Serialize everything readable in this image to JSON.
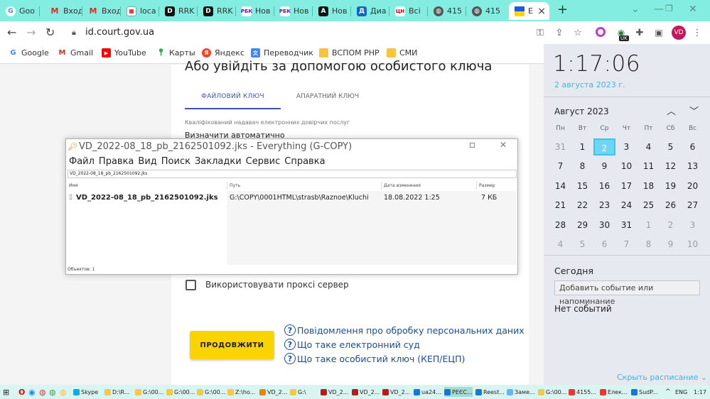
{
  "browser": {
    "tabs": [
      {
        "label": "Goo",
        "icon": "google-icon"
      },
      {
        "label": "Вход",
        "icon": "gmail-icon"
      },
      {
        "label": "Вход",
        "icon": "gmail-icon"
      },
      {
        "label": "loca",
        "icon": "localhost-icon"
      },
      {
        "label": "RRK",
        "icon": "rrk-icon"
      },
      {
        "label": "RRK",
        "icon": "rrk-icon"
      },
      {
        "label": "Нов",
        "icon": "rbc-icon"
      },
      {
        "label": "Нов",
        "icon": "rbc-icon"
      },
      {
        "label": "Нов",
        "icon": "news-a-icon"
      },
      {
        "label": "Диа",
        "icon": "dia-icon"
      },
      {
        "label": "Всі",
        "icon": "tsn-icon"
      },
      {
        "label": "415",
        "icon": "globe-icon"
      },
      {
        "label": "415",
        "icon": "globe-icon"
      },
      {
        "label": "Е",
        "icon": "ukraine-flag-icon"
      }
    ],
    "url": "id.court.gov.ua",
    "profile_initials": "VD",
    "extension_badge": "UK",
    "bookmarks": [
      {
        "label": "Google",
        "icon": "google-icon"
      },
      {
        "label": "Gmail",
        "icon": "gmail-icon"
      },
      {
        "label": "YouTube",
        "icon": "youtube-icon"
      },
      {
        "label": "Карты",
        "icon": "maps-icon"
      },
      {
        "label": "Яндекс",
        "icon": "yandex-icon"
      },
      {
        "label": "Переводчик",
        "icon": "translate-icon"
      },
      {
        "label": "ВСПОМ РНР",
        "icon": "folder-icon"
      },
      {
        "label": "СМИ",
        "icon": "folder-icon"
      }
    ]
  },
  "court_page": {
    "heading": "Або увійдіть за допомогою особистого ключа",
    "tab_file": "ФАЙЛОВИЙ КЛЮЧ",
    "tab_hardware": "АПАРАТНИЙ КЛЮЧ",
    "provider_label": "Кваліфікований надавач електронних довірчих послуг",
    "provider_value": "Визначити автоматично",
    "proxy_label": "Використовувати проксі сервер",
    "continue_button": "ПРОДОВЖИТИ",
    "links": [
      "Повідомлення про обробку персональних даних",
      "Що таке електронний суд",
      "Що таке особистий ключ (КЕП/ЕЦП)"
    ]
  },
  "everything_window": {
    "title": "VD_2022-08_18_pb_2162501092.jks - Everything (G-COPY)",
    "menu": [
      "Файл",
      "Правка",
      "Вид",
      "Поиск",
      "Закладки",
      "Сервис",
      "Справка"
    ],
    "search_value": "VD_2022-08_18_pb_2162501092.jks",
    "columns": [
      "Имя",
      "Путь",
      "Дата изменения",
      "Размер"
    ],
    "result": {
      "name": "VD_2022-08_18_pb_2162501092.jks",
      "path": "G:\\COPY\\0001HTML\\strasb\\Raznoe\\Kluchi",
      "modified": "18.08.2022 1:25",
      "size": "7 КБ"
    },
    "status": "Объектов: 1"
  },
  "calendar": {
    "time": "1:17:06",
    "date": "2 августа 2023 г.",
    "month": "Август 2023",
    "weekdays": [
      "Пн",
      "Вт",
      "Ср",
      "Чт",
      "Пт",
      "Сб",
      "Вс"
    ],
    "weeks": [
      [
        "31",
        "1",
        "2",
        "3",
        "4",
        "5",
        "6"
      ],
      [
        "7",
        "8",
        "9",
        "10",
        "11",
        "12",
        "13"
      ],
      [
        "14",
        "15",
        "16",
        "17",
        "18",
        "19",
        "20"
      ],
      [
        "21",
        "22",
        "23",
        "24",
        "25",
        "26",
        "27"
      ],
      [
        "28",
        "29",
        "30",
        "31",
        "1",
        "2",
        "3"
      ],
      [
        "4",
        "5",
        "6",
        "7",
        "8",
        "9",
        "10"
      ]
    ],
    "today_label": "Сегодня",
    "add_event": "Добавить событие или напоминание",
    "no_events": "Нет событий",
    "show_schedule": "Скрыть расписание"
  },
  "taskbar": {
    "items": [
      {
        "label": "Skype",
        "icon": "skype-icon"
      },
      {
        "label": "D:\\R...",
        "icon": "folder-icon"
      },
      {
        "label": "G:\\00...",
        "icon": "folder-icon"
      },
      {
        "label": "G:\\00...",
        "icon": "folder-icon"
      },
      {
        "label": "G:\\00...",
        "icon": "folder-icon"
      },
      {
        "label": "Z:\\ho...",
        "icon": "folder-icon"
      },
      {
        "label": "VD_2...",
        "icon": "everything-icon"
      },
      {
        "label": "G:\\",
        "icon": "folder-icon"
      },
      {
        "label": "VD_2...",
        "icon": "filezilla-icon"
      },
      {
        "label": "VD_2...",
        "icon": "filezilla-icon"
      },
      {
        "label": "VD_2...",
        "icon": "filezilla-icon"
      },
      {
        "label": "ua24...",
        "icon": "app-icon"
      },
      {
        "label": "РЕЄС...",
        "icon": "app-icon"
      },
      {
        "label": "Reest...",
        "icon": "app-icon"
      },
      {
        "label": "Заме...",
        "icon": "notepad-icon"
      },
      {
        "label": "G:\\00...",
        "icon": "folder-icon"
      },
      {
        "label": "4155...",
        "icon": "chrome-icon"
      },
      {
        "label": "Елек...",
        "icon": "chrome-icon"
      },
      {
        "label": "SudP...",
        "icon": "app-icon"
      }
    ],
    "language": "ENG",
    "clock": "1:17"
  }
}
